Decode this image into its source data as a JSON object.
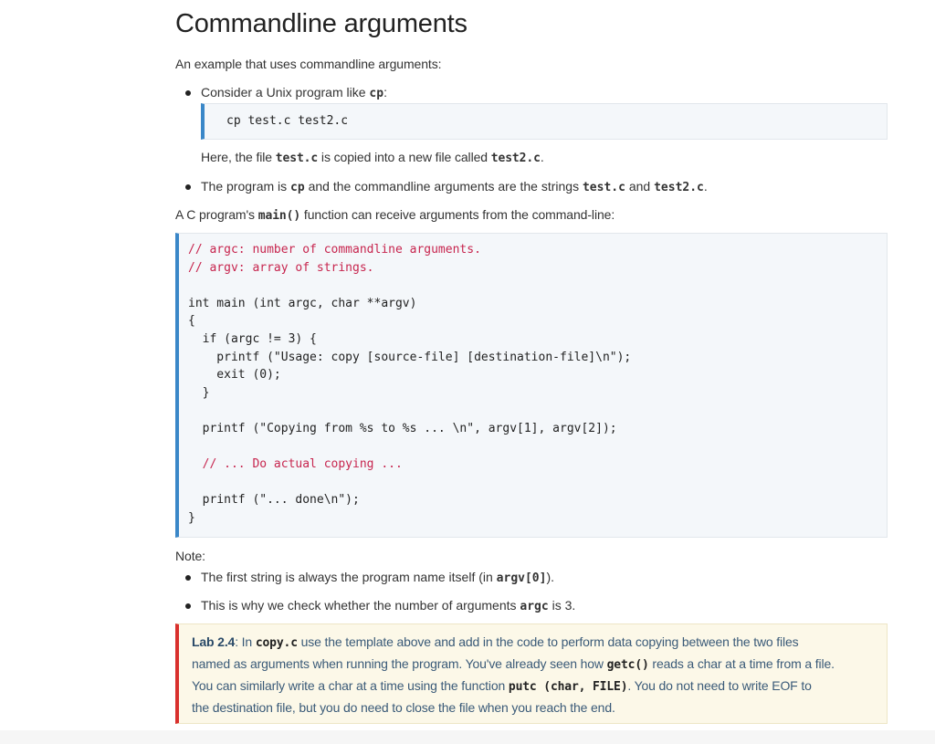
{
  "heading": "Commandline arguments",
  "intro": "An example that uses commandline arguments:",
  "bullet1": {
    "text": "Consider a Unix program like ",
    "code": "cp",
    "suffix": ":"
  },
  "codebox1": {
    "line": "cp test.c test2.c"
  },
  "here_line": {
    "t1": "Here, the file ",
    "c1": "test.c",
    "t2": " is copied into a new file called ",
    "c2": "test2.c",
    "t3": "."
  },
  "bullet2": {
    "t1": "The program is ",
    "c1": "cp",
    "t2": " and the commandline arguments are the strings ",
    "c2": "test.c",
    "t3": " and ",
    "c3": "test2.c",
    "t4": "."
  },
  "main_line": {
    "t1": "A C program's ",
    "c1": "main()",
    "t2": " function can receive arguments from the command-line:"
  },
  "codebox2": {
    "lines": [
      "// argc: number of commandline arguments.",
      "// argv: array of strings.",
      "",
      "int main (int argc, char **argv)",
      "{",
      "  if (argc != 3) {",
      "    printf (\"Usage: copy [source-file] [destination-file]\\n\");",
      "    exit (0);",
      "  }",
      "",
      "  printf (\"Copying from %s to %s ... \\n\", argv[1], argv[2]);",
      "",
      "  // ... Do actual copying ...",
      "",
      "  printf (\"... done\\n\");",
      "}"
    ]
  },
  "note_label": "Note:",
  "note1": {
    "t1": "The first string is always the program name itself (in ",
    "c1": "argv[0]",
    "t2": ")."
  },
  "note2": {
    "t1": "This is why we check whether the number of arguments ",
    "c1": "argc",
    "t2": " is 3."
  },
  "lab": {
    "title": "Lab 2.4",
    "l1_t1": ": In ",
    "l1_c1": "copy.c",
    "l1_t2": " use the template above and add in the code to perform data copying between the two files",
    "l2_t1": "named as arguments when running the program. You've already seen how ",
    "l2_c1": "getc()",
    "l2_t2": " reads a char at a time from a file.",
    "l3_t1": "You can similarly write a char at a time using the function ",
    "l3_c1": "putc (char, FILE)",
    "l3_t2": ". You do not need to write EOF to",
    "l4_t1": "the destination file, but you do need to close the file when you reach the end."
  },
  "colors": {
    "code_border": "#3a87c8",
    "lab_border": "#d9302d",
    "comment": "#c7254e",
    "lab_bg": "#fcf8e8",
    "code_bg": "#f4f7fa"
  }
}
